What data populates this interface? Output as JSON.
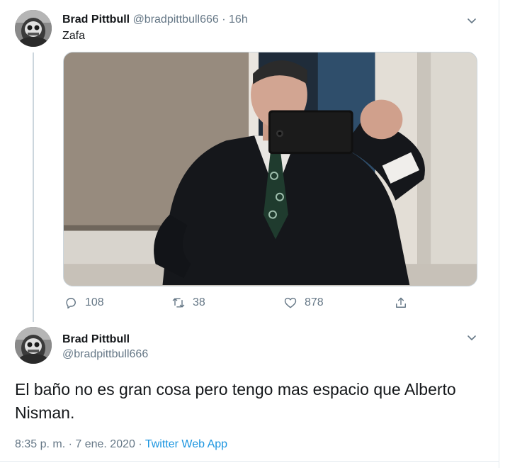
{
  "tweet1": {
    "name": "Brad Pittbull",
    "handle": "@bradpittbull666",
    "separator": "·",
    "time": "16h",
    "text": "Zafa",
    "actions": {
      "replies": "108",
      "retweets": "38",
      "likes": "878"
    }
  },
  "tweet2": {
    "name": "Brad Pittbull",
    "handle": "@bradpittbull666",
    "text": "El baño no es gran cosa pero tengo mas espacio que Alberto Nisman.",
    "timestamp": "8:35 p. m. · 7 ene. 2020",
    "separator": " · ",
    "app": "Twitter Web App"
  },
  "icons": {
    "reply": "reply-icon",
    "retweet": "retweet-icon",
    "like": "heart-icon",
    "share": "share-icon",
    "more": "chevron-down-icon"
  },
  "colors": {
    "text_primary": "#14171a",
    "text_secondary": "#657786",
    "link": "#1b95e0",
    "border": "#ccd6dd"
  }
}
